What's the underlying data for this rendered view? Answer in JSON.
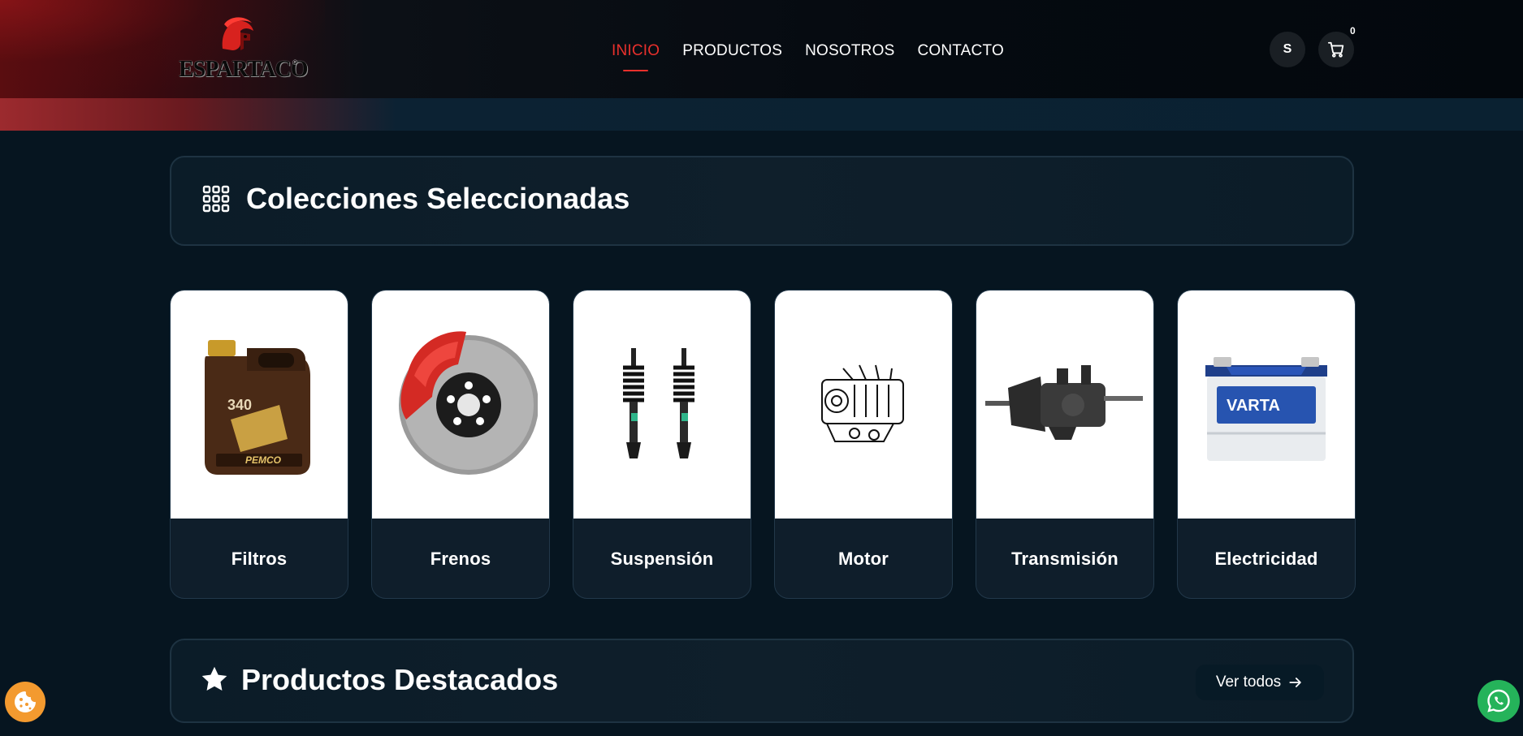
{
  "brand": {
    "name": "ESPARTACO",
    "registered_mark": "®",
    "logo_icon": "spartan-helmet-icon"
  },
  "nav": {
    "items": [
      {
        "label": "INICIO",
        "active": true
      },
      {
        "label": "PRODUCTOS",
        "active": false
      },
      {
        "label": "NOSOTROS",
        "active": false
      },
      {
        "label": "CONTACTO",
        "active": false
      }
    ]
  },
  "header_actions": {
    "user_initial": "S",
    "cart_icon": "cart-icon",
    "cart_count": "0"
  },
  "collections": {
    "title": "Colecciones Seleccionadas",
    "icon": "grid-icon",
    "items": [
      {
        "label": "Filtros",
        "image": "oil-can-image"
      },
      {
        "label": "Frenos",
        "image": "brake-disc-image"
      },
      {
        "label": "Suspensión",
        "image": "shock-absorbers-image"
      },
      {
        "label": "Motor",
        "image": "engine-image"
      },
      {
        "label": "Transmisión",
        "image": "gearbox-image"
      },
      {
        "label": "Electricidad",
        "image": "battery-image"
      }
    ]
  },
  "featured": {
    "title": "Productos Destacados",
    "icon": "star-icon",
    "see_all_label": "Ver todos"
  },
  "floating": {
    "cookie_icon": "cookie-icon",
    "whatsapp_icon": "whatsapp-icon"
  },
  "colors": {
    "accent": "#e8302c",
    "background": "#061520",
    "card": "#0f1e2b",
    "whatsapp": "#25b35a",
    "cookie": "#f39a2f"
  }
}
